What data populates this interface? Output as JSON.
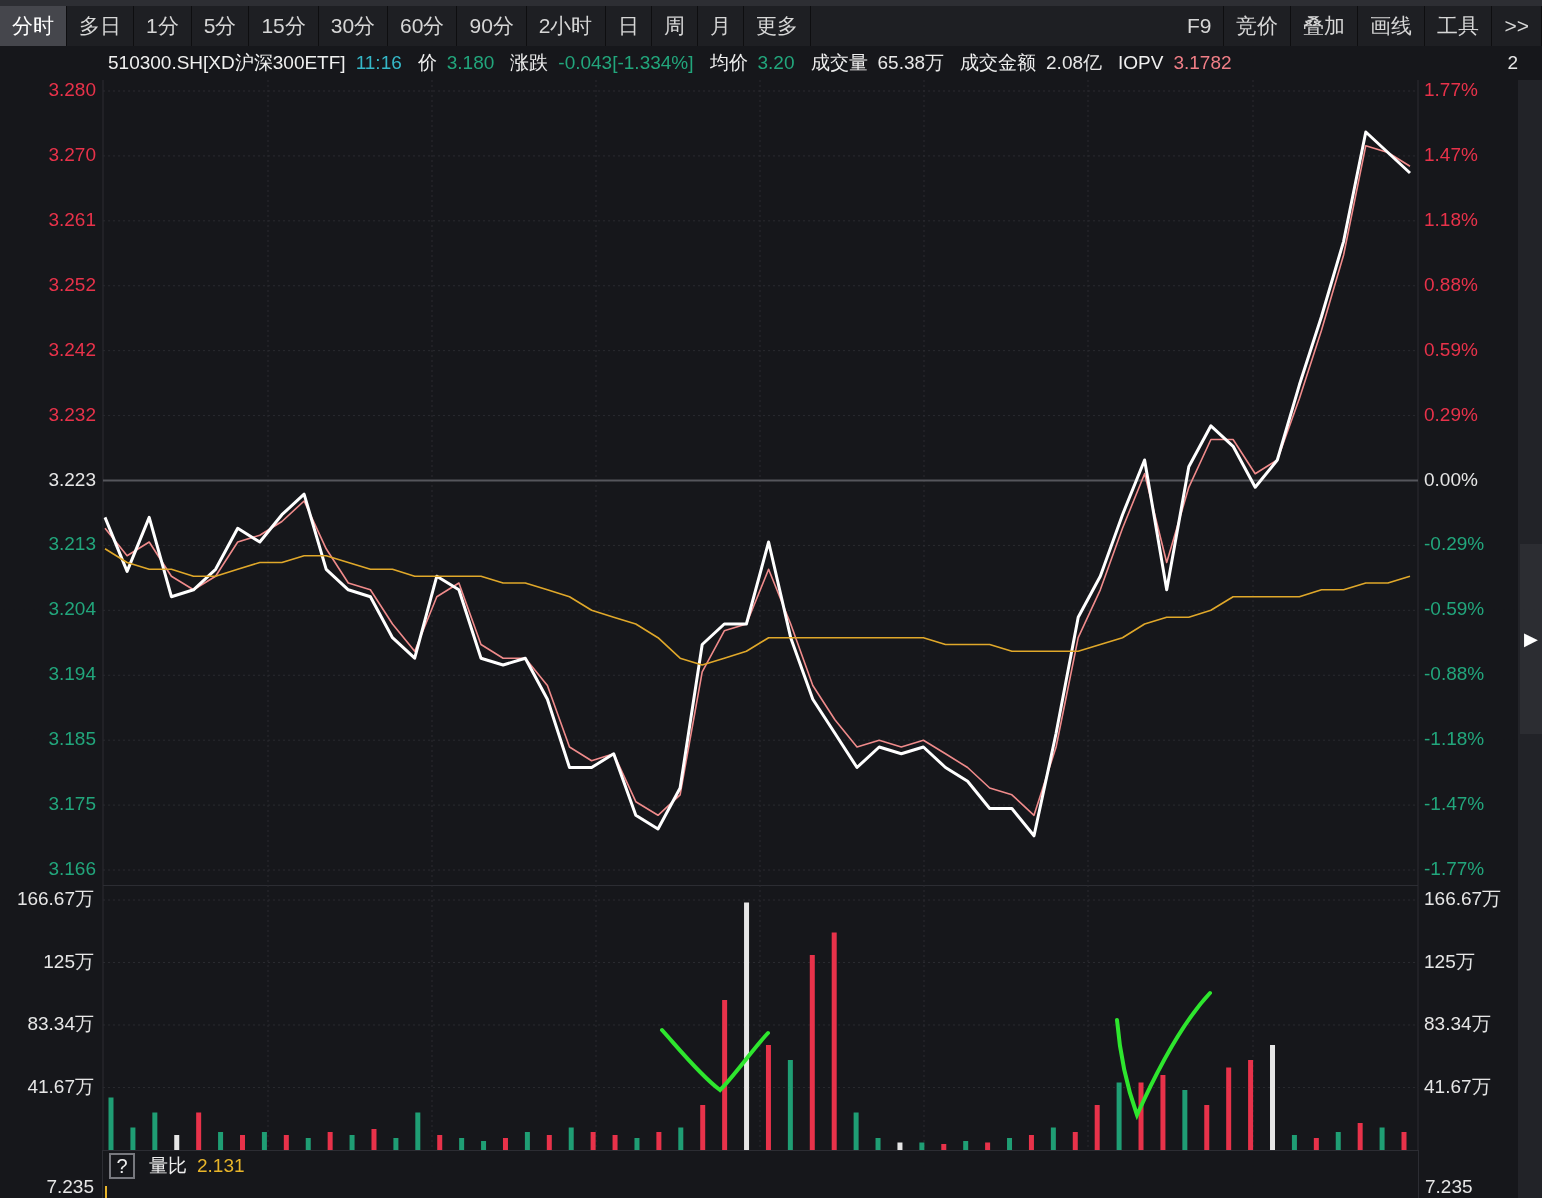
{
  "toolbar": {
    "tabs": [
      {
        "label": "分时",
        "selected": true
      },
      {
        "label": "多日",
        "selected": false
      },
      {
        "label": "1分",
        "selected": false
      },
      {
        "label": "5分",
        "selected": false
      },
      {
        "label": "15分",
        "selected": false
      },
      {
        "label": "30分",
        "selected": false
      },
      {
        "label": "60分",
        "selected": false
      },
      {
        "label": "90分",
        "selected": false
      },
      {
        "label": "2小时",
        "selected": false
      },
      {
        "label": "日",
        "selected": false
      },
      {
        "label": "周",
        "selected": false
      },
      {
        "label": "月",
        "selected": false
      },
      {
        "label": "更多",
        "selected": false
      }
    ],
    "tools": [
      "F9",
      "竞价",
      "叠加",
      "画线",
      "工具",
      ">>"
    ]
  },
  "info_bar": {
    "symbol": "510300.SH[XD沪深300ETF]",
    "time": "11:16",
    "fields": [
      {
        "label": "价",
        "value": "3.180",
        "color": "#22a67c"
      },
      {
        "label": "涨跌",
        "value": "-0.043[-1.334%]",
        "color": "#22a67c"
      },
      {
        "label": "均价",
        "value": "3.20",
        "color": "#22a67c"
      },
      {
        "label": "成交量",
        "value": "65.38万",
        "color": "#e8e8e8"
      },
      {
        "label": "成交金额",
        "value": "2.08亿",
        "color": "#e8e8e8"
      },
      {
        "label": "IOPV",
        "value": "3.1782",
        "color": "#f07e86"
      }
    ],
    "cut_text": "2"
  },
  "price_panel": {
    "chart_data": {
      "type": "line",
      "grid": true,
      "ref_lines": [
        {
          "axis": "y",
          "value": 3.223
        }
      ],
      "ylim": [
        3.166,
        3.28
      ],
      "yticks": [
        {
          "value": 3.28,
          "label": "3.280"
        },
        {
          "value": 3.2705,
          "label": "3.270"
        },
        {
          "value": 3.261,
          "label": "3.261"
        },
        {
          "value": 3.2515,
          "label": "3.252"
        },
        {
          "value": 3.242,
          "label": "3.242"
        },
        {
          "value": 3.2325,
          "label": "3.232"
        },
        {
          "value": 3.223,
          "label": "3.223"
        },
        {
          "value": 3.2135,
          "label": "3.213"
        },
        {
          "value": 3.204,
          "label": "3.204"
        },
        {
          "value": 3.1945,
          "label": "3.194"
        },
        {
          "value": 3.185,
          "label": "3.185"
        },
        {
          "value": 3.1755,
          "label": "3.175"
        },
        {
          "value": 3.166,
          "label": "3.166"
        }
      ],
      "series": [
        {
          "color": "#f08b8b",
          "values": [
            3.216,
            3.212,
            3.214,
            3.209,
            3.207,
            3.209,
            3.214,
            3.215,
            3.217,
            3.22,
            3.213,
            3.208,
            3.207,
            3.202,
            3.198,
            3.206,
            3.208,
            3.199,
            3.197,
            3.197,
            3.193,
            3.184,
            3.182,
            3.183,
            3.176,
            3.174,
            3.177,
            3.195,
            3.201,
            3.202,
            3.21,
            3.202,
            3.193,
            3.188,
            3.184,
            3.185,
            3.184,
            3.185,
            3.183,
            3.181,
            3.178,
            3.177,
            3.174,
            3.184,
            3.2,
            3.207,
            3.216,
            3.224,
            3.211,
            3.222,
            3.229,
            3.229,
            3.224,
            3.226,
            3.235,
            3.245,
            3.256,
            3.272,
            3.271,
            3.269
          ]
        },
        {
          "color": "#ffffff",
          "values": [
            3.2176,
            3.2097,
            3.2176,
            3.206,
            3.207,
            3.21,
            3.216,
            3.214,
            3.218,
            3.221,
            3.21,
            3.207,
            3.206,
            3.2,
            3.197,
            3.209,
            3.207,
            3.197,
            3.196,
            3.197,
            3.191,
            3.181,
            3.181,
            3.183,
            3.174,
            3.172,
            3.178,
            3.199,
            3.202,
            3.202,
            3.214,
            3.2,
            3.191,
            3.186,
            3.181,
            3.184,
            3.183,
            3.184,
            3.181,
            3.179,
            3.175,
            3.175,
            3.171,
            3.186,
            3.203,
            3.209,
            3.218,
            3.226,
            3.207,
            3.225,
            3.231,
            3.228,
            3.222,
            3.226,
            3.237,
            3.247,
            3.258,
            3.274,
            3.271,
            3.268
          ]
        },
        {
          "color": "#e0a82a",
          "values": [
            3.213,
            3.211,
            3.21,
            3.21,
            3.209,
            3.209,
            3.21,
            3.211,
            3.211,
            3.212,
            3.212,
            3.211,
            3.21,
            3.21,
            3.209,
            3.209,
            3.209,
            3.209,
            3.208,
            3.208,
            3.207,
            3.206,
            3.204,
            3.203,
            3.202,
            3.2,
            3.197,
            3.196,
            3.197,
            3.198,
            3.2,
            3.2,
            3.2,
            3.2,
            3.2,
            3.2,
            3.2,
            3.2,
            3.199,
            3.199,
            3.199,
            3.198,
            3.198,
            3.198,
            3.198,
            3.199,
            3.2,
            3.202,
            3.203,
            3.203,
            3.204,
            3.206,
            3.206,
            3.206,
            3.206,
            3.207,
            3.207,
            3.208,
            3.208,
            3.209
          ]
        }
      ]
    },
    "percent_labels": [
      {
        "label": "1.77%",
        "kind": "up"
      },
      {
        "label": "1.47%",
        "kind": "up"
      },
      {
        "label": "1.18%",
        "kind": "up"
      },
      {
        "label": "0.88%",
        "kind": "up"
      },
      {
        "label": "0.59%",
        "kind": "up"
      },
      {
        "label": "0.29%",
        "kind": "up"
      },
      {
        "label": "0.00%",
        "kind": "flat"
      },
      {
        "label": "-0.29%",
        "kind": "down"
      },
      {
        "label": "-0.59%",
        "kind": "down"
      },
      {
        "label": "-0.88%",
        "kind": "down"
      },
      {
        "label": "-1.18%",
        "kind": "down"
      },
      {
        "label": "-1.47%",
        "kind": "down"
      },
      {
        "label": "-1.77%",
        "kind": "down"
      }
    ]
  },
  "volume_panel": {
    "chart_data": {
      "type": "bar",
      "grid": true,
      "ylim": [
        0,
        166.67
      ],
      "yticks": [
        {
          "value": 166.67,
          "label": "166.67万"
        },
        {
          "value": 125,
          "label": "125万"
        },
        {
          "value": 83.34,
          "label": "83.34万"
        },
        {
          "value": 41.67,
          "label": "41.67万"
        }
      ],
      "series": [
        {
          "color": "#e8324a",
          "values": [
            null,
            null,
            null,
            null,
            25,
            null,
            10,
            null,
            10,
            null,
            12,
            null,
            14,
            null,
            null,
            10,
            null,
            null,
            8,
            null,
            10,
            null,
            12,
            10,
            null,
            12,
            null,
            30,
            100,
            null,
            70,
            null,
            130,
            145,
            null,
            null,
            null,
            null,
            4,
            null,
            5,
            null,
            10,
            null,
            12,
            30,
            null,
            45,
            50,
            null,
            30,
            55,
            60,
            null,
            null,
            8,
            null,
            18,
            null,
            12
          ]
        },
        {
          "color": "#1f9e74",
          "values": [
            35,
            15,
            25,
            null,
            null,
            12,
            null,
            12,
            null,
            8,
            null,
            10,
            null,
            8,
            25,
            null,
            8,
            6,
            null,
            12,
            null,
            15,
            null,
            null,
            8,
            null,
            15,
            null,
            null,
            null,
            null,
            60,
            null,
            null,
            25,
            8,
            null,
            5,
            null,
            6,
            null,
            8,
            null,
            15,
            null,
            null,
            45,
            null,
            null,
            40,
            null,
            null,
            null,
            null,
            10,
            null,
            12,
            null,
            15,
            null
          ]
        },
        {
          "color": "#e6e6e6",
          "values": [
            null,
            null,
            null,
            10,
            null,
            null,
            null,
            null,
            null,
            null,
            null,
            null,
            null,
            null,
            null,
            null,
            null,
            null,
            null,
            null,
            null,
            null,
            null,
            null,
            null,
            null,
            null,
            null,
            null,
            165,
            null,
            null,
            null,
            null,
            null,
            null,
            5,
            null,
            null,
            null,
            null,
            null,
            null,
            null,
            null,
            null,
            null,
            null,
            null,
            null,
            null,
            null,
            null,
            70,
            null,
            null,
            null,
            null,
            null,
            null
          ]
        }
      ]
    },
    "right_labels": [
      "166.67万",
      "125万",
      "83.34万",
      "41.67万"
    ]
  },
  "ratio_panel": {
    "help_button": "?",
    "label": "量比",
    "value": "2.131",
    "left_label": "7.235",
    "right_label": "7.235"
  },
  "side_toggle": "▶"
}
